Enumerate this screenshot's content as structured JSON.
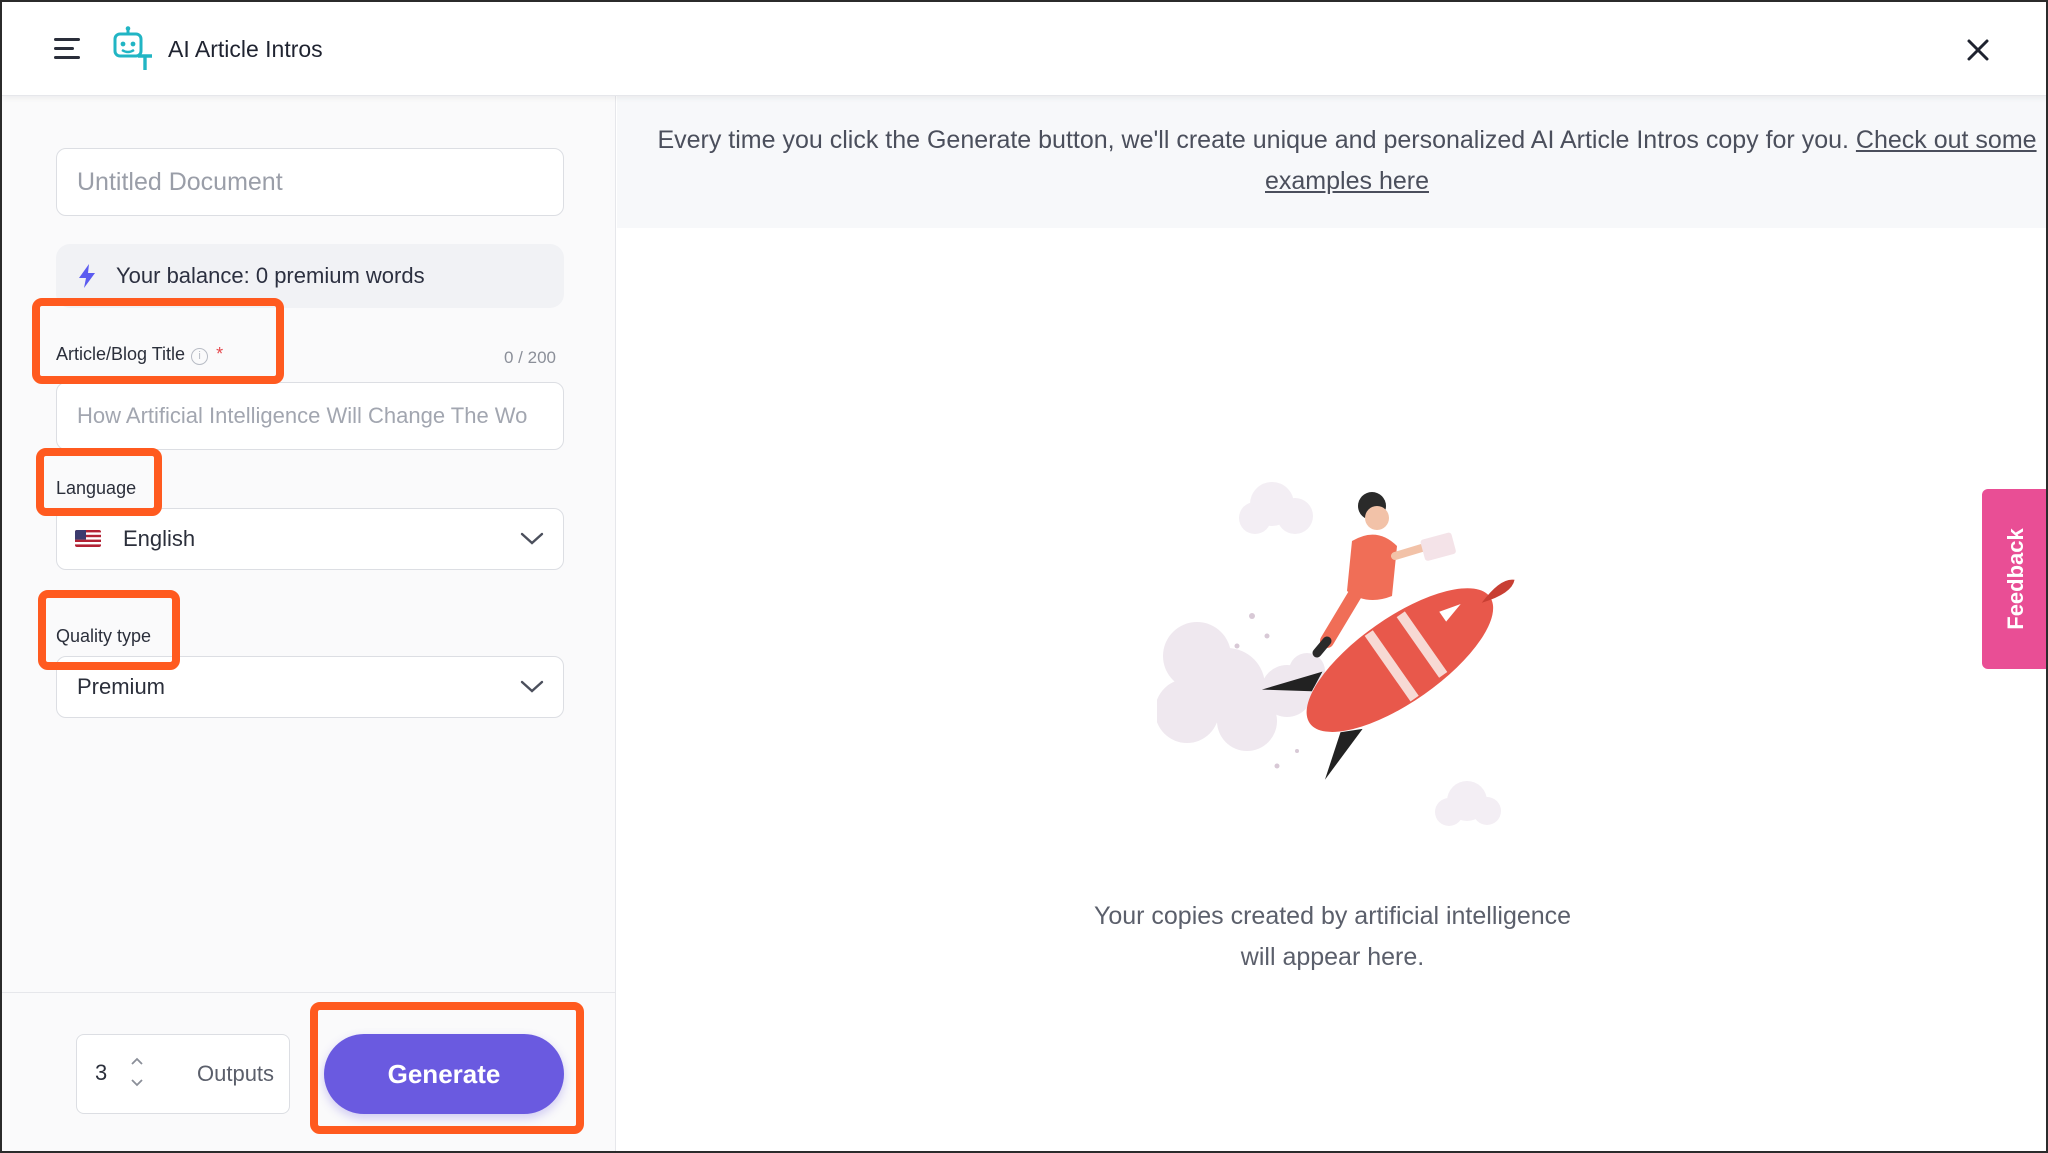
{
  "header": {
    "title": "AI Article Intros"
  },
  "form": {
    "document_placeholder": "Untitled Document",
    "balance": "Your balance: 0 premium words",
    "title_label": "Article/Blog Title",
    "required_mark": "*",
    "title_counter": "0 / 200",
    "title_placeholder": "How Artificial Intelligence Will Change The Wo",
    "language_label": "Language",
    "language_value": "English",
    "quality_label": "Quality type",
    "quality_value": "Premium"
  },
  "footer": {
    "outputs_value": "3",
    "outputs_label": "Outputs",
    "generate_label": "Generate"
  },
  "notice": {
    "text": "Every time you click the Generate button, we'll create unique and personalized AI Article Intros copy for you.",
    "link_text": "Check out some examples here"
  },
  "empty_state": {
    "line1": "Your copies created by artificial intelligence",
    "line2": "will appear here."
  },
  "feedback": {
    "label": "Feedback"
  },
  "colors": {
    "accent": "#6a5ae0",
    "feedback": "#e94e95",
    "highlight": "#ff5a1f",
    "logo": "#21b5c4"
  },
  "icons": [
    "menu-icon",
    "robot-logo-icon",
    "close-icon",
    "bolt-icon",
    "info-icon",
    "us-flag-icon",
    "chevron-down-icon",
    "chevron-up-icon",
    "rocket-illustration"
  ]
}
